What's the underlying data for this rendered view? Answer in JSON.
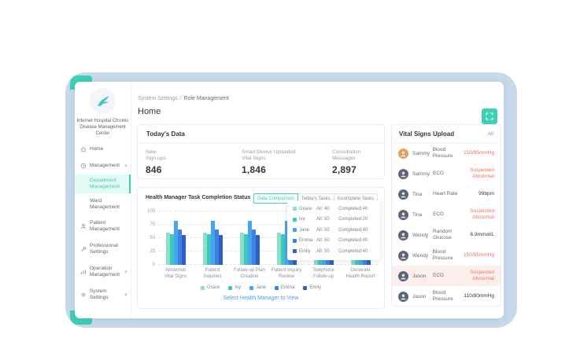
{
  "org": {
    "name_lines": [
      "Internet Hospital Chronic",
      "Disease Management",
      "Center"
    ]
  },
  "breadcrumb": {
    "items": [
      "System Settings",
      "Role Management"
    ],
    "separator": "/"
  },
  "page": {
    "title": "Home"
  },
  "sidebar": {
    "items": [
      {
        "label": "Home",
        "icon": "home-icon"
      },
      {
        "label": "Management",
        "icon": "management-icon",
        "caret": "up"
      },
      {
        "label": "Department Management",
        "child": true,
        "active": true
      },
      {
        "label": "Ward Management",
        "child": true
      },
      {
        "label": "Patient Management",
        "icon": "patient-icon"
      },
      {
        "label": "Professional Settings",
        "icon": "professional-icon"
      },
      {
        "label": "Operation Management",
        "icon": "operation-icon",
        "caret": "down"
      },
      {
        "label": "System Settings",
        "icon": "settings-icon",
        "caret": "down"
      }
    ]
  },
  "today": {
    "title": "Today's Data",
    "stats": [
      {
        "label_lines": [
          "New",
          "Sign-ups"
        ],
        "value": "846"
      },
      {
        "label_lines": [
          "Smart Device Uploaded",
          "Vital Signs"
        ],
        "value": "1,846"
      },
      {
        "label_lines": [
          "Consultation",
          "Messages"
        ],
        "value": "2,897"
      }
    ]
  },
  "chart_section": {
    "title": "Health Manager Task Completion Status",
    "tabs": [
      {
        "label": "Data Comparison",
        "active": true
      },
      {
        "label": "Today's Tasks",
        "active": false
      },
      {
        "label": "Incomplete Tasks",
        "active": false
      }
    ],
    "overlay_legend": [
      {
        "name": "Grace",
        "all": "All: 40",
        "completed": "Completed:40"
      },
      {
        "name": "Ivy",
        "all": "All: 50",
        "completed": "Completed:20"
      },
      {
        "name": "Jane",
        "all": "All: 50",
        "completed": "Completed:40"
      },
      {
        "name": "Emma",
        "all": "All: 50",
        "completed": "Completed:40"
      },
      {
        "name": "Emily",
        "all": "All: 50",
        "completed": "Completed:40"
      }
    ],
    "link": "Select Health Manager to View"
  },
  "chart_data": {
    "type": "bar",
    "title": "Health Manager Task Completion Status",
    "categories": [
      "Abnormal Vital Signs",
      "Patient Inquiries",
      "Follow-up Plan Creation",
      "Patient Inquiry Review",
      "Telephone Follow-up",
      "Generate Health Report"
    ],
    "category_lines": [
      [
        "Abnormal",
        "Vital Signs"
      ],
      [
        "Patient",
        "Inquiries"
      ],
      [
        "Follow-up Plan",
        "Creation"
      ],
      [
        "Patient Inquiry",
        "Review"
      ],
      [
        "Telephone",
        "Follow-up"
      ],
      [
        "Generate",
        "Health Report"
      ]
    ],
    "series": [
      {
        "name": "Grace",
        "color": "#8be0c8",
        "values": [
          60,
          60,
          60,
          60,
          12,
          12
        ]
      },
      {
        "name": "Ivy",
        "color": "#3fc8c0",
        "values": [
          58,
          58,
          58,
          58,
          12,
          12
        ]
      },
      {
        "name": "Jane",
        "color": "#45a5f0",
        "values": [
          82,
          82,
          82,
          82,
          12,
          12
        ]
      },
      {
        "name": "Emma",
        "color": "#3f80e0",
        "values": [
          66,
          66,
          66,
          66,
          12,
          12
        ]
      },
      {
        "name": "Emily",
        "color": "#2e5fc2",
        "values": [
          56,
          56,
          56,
          56,
          12,
          12
        ]
      }
    ],
    "xlabel": "",
    "ylabel": "",
    "ylim": [
      0,
      100
    ],
    "yticks": [
      0,
      25,
      50,
      75,
      100
    ],
    "grid": "dashed-horizontal",
    "legend_position": "bottom"
  },
  "vital_signs": {
    "title": "Vital Signs Upload",
    "action": "All",
    "rows": [
      {
        "name": "Sammy",
        "metric": "Blood Pressure",
        "value": "150/95mmHg",
        "abnormal": true,
        "highlighted": false,
        "avatar_color": "#e0a264"
      },
      {
        "name": "Sammy",
        "metric": "ECG",
        "value": "Suspected Abnormal",
        "abnormal": true,
        "highlighted": false,
        "avatar_color": "#5d6678"
      },
      {
        "name": "Tina",
        "metric": "Heart Rate",
        "value": "99bpm",
        "abnormal": false,
        "highlighted": false,
        "avatar_color": "#5d6678"
      },
      {
        "name": "Tina",
        "metric": "ECG",
        "value": "Suspected Abnormal",
        "abnormal": true,
        "highlighted": false,
        "avatar_color": "#5d6678"
      },
      {
        "name": "Wendy",
        "metric": "Random Glucose",
        "value": "6.9mmol/L",
        "abnormal": false,
        "highlighted": false,
        "avatar_color": "#5d6678"
      },
      {
        "name": "Wendy",
        "metric": "Blood Pressure",
        "value": "150/95mmHg",
        "abnormal": true,
        "highlighted": false,
        "avatar_color": "#5d6678"
      },
      {
        "name": "Jason",
        "metric": "ECG",
        "value": "Suspected Abnormal",
        "abnormal": true,
        "highlighted": true,
        "avatar_color": "#5d6678"
      },
      {
        "name": "Jason",
        "metric": "Blood Pressure",
        "value": "110/80mmHg",
        "abnormal": false,
        "highlighted": false,
        "avatar_color": "#5d6678"
      }
    ]
  },
  "colors": {
    "accent_teal": "#3ecfb4",
    "shell_blue": "#c7daeb",
    "link_blue": "#4aa0f6",
    "abnormal_red": "#f0735f",
    "highlight_row_bg": "#fdf0ec"
  }
}
